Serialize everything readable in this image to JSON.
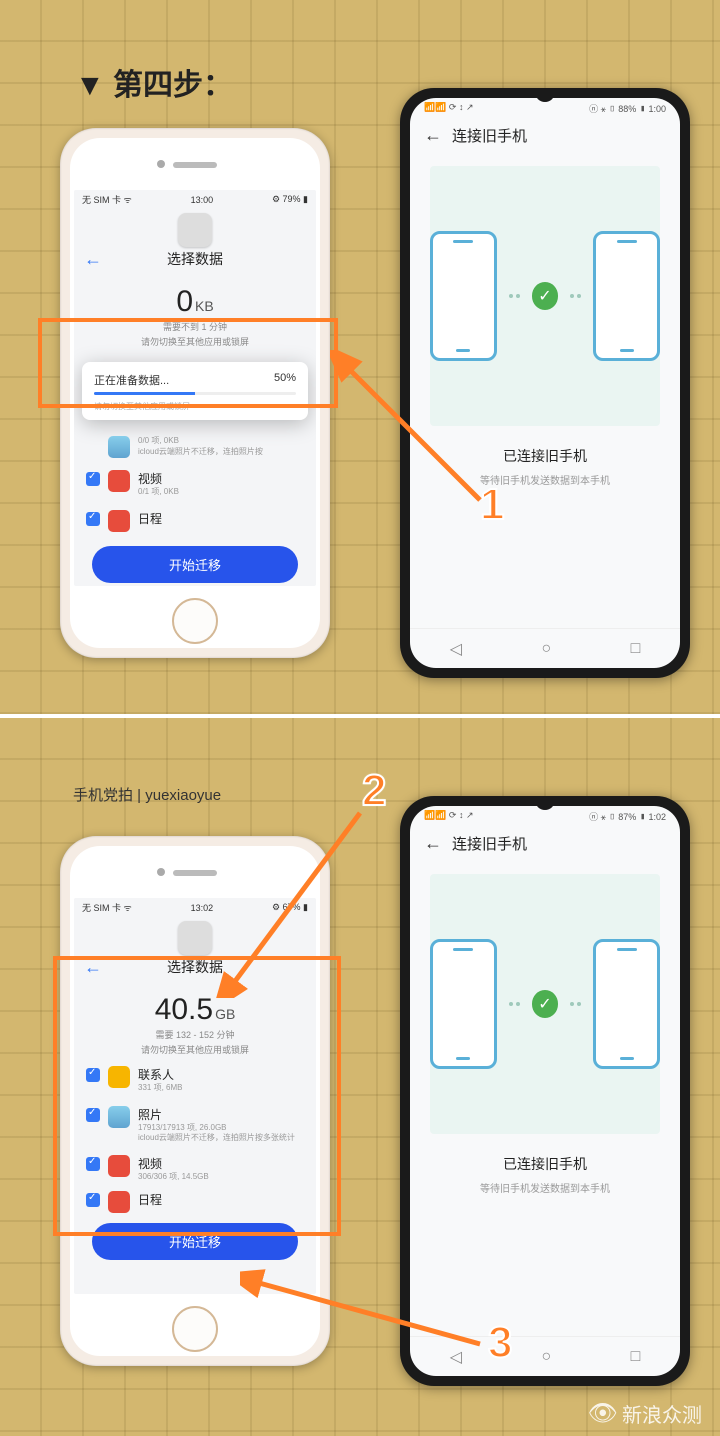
{
  "step_title": "▼ 第四步：",
  "watermark": "手机党拍 | yuexiaoyue",
  "sina": "新浪众测",
  "annotations": {
    "n1": "1",
    "n2": "2",
    "n3": "3"
  },
  "iphone1": {
    "status_left": "无 SIM 卡 ᯤ",
    "status_time": "13:00",
    "status_right": "⚙ 79% ▮",
    "title": "选择数据",
    "size_num": "0",
    "size_unit": "KB",
    "sub1": "需要不到 1 分钟",
    "sub2": "请勿切换至其他应用或锁屏",
    "popup_title": "正在准备数据...",
    "popup_pct": "50%",
    "popup_note": "请勿切换至其他应用或锁屏",
    "item_photo_sub": "0/0 项, 0KB",
    "item_photo_note": "icloud云端照片不迁移，连拍照片按",
    "item_video": "视频",
    "item_video_sub": "0/1 项, 0KB",
    "item_cal": "日程",
    "start_btn": "开始迁移"
  },
  "iphone2": {
    "status_left": "无 SIM 卡 ᯤ",
    "status_time": "13:02",
    "status_right": "⚙ 67% ▮",
    "title": "选择数据",
    "size_num": "40.5",
    "size_unit": "GB",
    "sub1": "需要 132 - 152 分钟",
    "sub2": "请勿切换至其他应用或锁屏",
    "item_contact": "联系人",
    "item_contact_sub": "331 项, 6MB",
    "item_photo": "照片",
    "item_photo_sub": "17913/17913 项, 26.0GB",
    "item_photo_note": "icloud云端照片不迁移，连拍照片按多张统计",
    "item_video": "视频",
    "item_video_sub": "306/306 项, 14.5GB",
    "item_cal": "日程",
    "start_btn": "开始迁移"
  },
  "huawei1": {
    "status_right": "ⓝ ⚹ ▯ 88% ▮ 1:00",
    "title": "连接旧手机",
    "connected": "已连接旧手机",
    "waiting": "等待旧手机发送数据到本手机"
  },
  "huawei2": {
    "status_right": "ⓝ ⚹ ▯ 87% ▮ 1:02",
    "title": "连接旧手机",
    "connected": "已连接旧手机",
    "waiting": "等待旧手机发送数据到本手机"
  }
}
